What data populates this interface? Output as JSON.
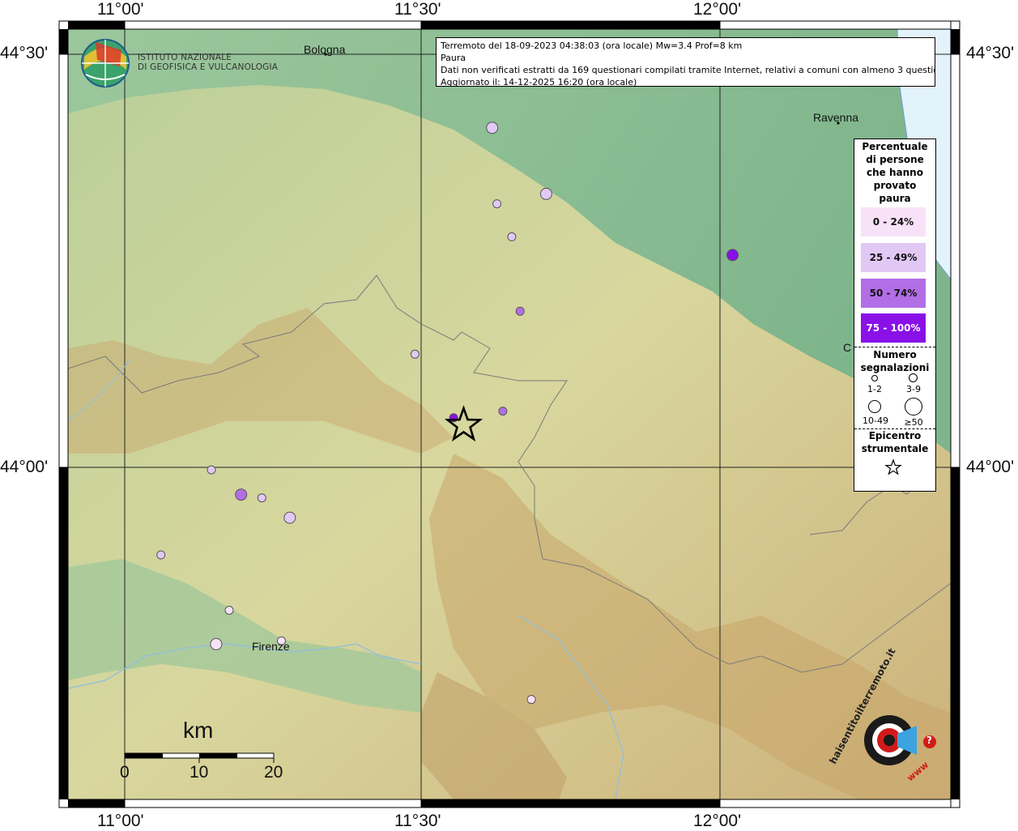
{
  "header": {
    "line1": "Terremoto del 18-09-2023 04:38:03 (ora locale) Mw=3.4 Prof=8 km",
    "line2": "Paura",
    "line3": "Dati non verificati estratti da 169 questionari compilati tramite Internet, relativi a comuni con almeno 3 questionari.",
    "line4": "Aggiornato il: 14-12-2025 16:20 (ora locale)"
  },
  "logo": {
    "line1": "ISTITUTO NAZIONALE",
    "line2": "DI GEOFISICA E VULCANOLOGIA"
  },
  "coords": {
    "top": [
      "11°00'",
      "11°30'",
      "12°00'"
    ],
    "bottom": [
      "11°00'",
      "11°30'",
      "12°00'"
    ],
    "left": [
      "44°30'",
      "44°00'"
    ],
    "right": [
      "44°30'",
      "44°00'"
    ]
  },
  "cities": {
    "bologna": "Bologna",
    "ravenna": "Ravenna",
    "firenze": "Firenze",
    "cesena_partial": "C"
  },
  "legend": {
    "title": "Percentuale di persone che hanno provato paura",
    "classes": [
      {
        "label": "0 - 24%",
        "color": "#f8e2f8"
      },
      {
        "label": "25 - 49%",
        "color": "#e2c8f4"
      },
      {
        "label": "50 - 74%",
        "color": "#b26ee6"
      },
      {
        "label": "75 - 100%",
        "color": "#8a10e8"
      }
    ],
    "count_title": "Numero segnalazioni",
    "count_labels": [
      "1-2",
      "3-9",
      "10-49",
      "≥50"
    ],
    "epicenter_title": "Epicentro strumentale"
  },
  "scale": {
    "title": "km",
    "ticks": [
      "0",
      "10",
      "20"
    ]
  },
  "stamp": {
    "text": "haisentitoilterremoto.it",
    "url": "www",
    "mark": "?"
  },
  "points": [
    {
      "lon": 11.619,
      "lat": 44.411,
      "fear": "25 - 49%",
      "count": "3-9"
    },
    {
      "lon": 11.627,
      "lat": 44.319,
      "fear": "25 - 49%",
      "count": "1-2"
    },
    {
      "lon": 11.71,
      "lat": 44.331,
      "fear": "25 - 49%",
      "count": "3-9"
    },
    {
      "lon": 11.652,
      "lat": 44.279,
      "fear": "25 - 49%",
      "count": "1-2"
    },
    {
      "lon": 11.666,
      "lat": 44.189,
      "fear": "50 - 74%",
      "count": "1-2"
    },
    {
      "lon": 11.489,
      "lat": 44.137,
      "fear": "25 - 49%",
      "count": "1-2"
    },
    {
      "lon": 11.637,
      "lat": 44.068,
      "fear": "50 - 74%",
      "count": "1-2"
    },
    {
      "lon": 11.554,
      "lat": 44.06,
      "fear": "75 - 100%",
      "count": "1-2"
    },
    {
      "lon": 12.024,
      "lat": 44.257,
      "fear": "75 - 100%",
      "count": "3-9"
    },
    {
      "lon": 11.146,
      "lat": 43.997,
      "fear": "25 - 49%",
      "count": "1-2"
    },
    {
      "lon": 11.196,
      "lat": 43.967,
      "fear": "50 - 74%",
      "count": "3-9"
    },
    {
      "lon": 11.231,
      "lat": 43.963,
      "fear": "25 - 49%",
      "count": "1-2"
    },
    {
      "lon": 11.278,
      "lat": 43.939,
      "fear": "25 - 49%",
      "count": "3-9"
    },
    {
      "lon": 11.061,
      "lat": 43.894,
      "fear": "25 - 49%",
      "count": "1-2"
    },
    {
      "lon": 11.176,
      "lat": 43.827,
      "fear": "0 - 24%",
      "count": "1-2"
    },
    {
      "lon": 11.154,
      "lat": 43.786,
      "fear": "0 - 24%",
      "count": "3-9"
    },
    {
      "lon": 11.264,
      "lat": 43.79,
      "fear": "0 - 24%",
      "count": "1-2"
    },
    {
      "lon": 11.685,
      "lat": 43.719,
      "fear": "0 - 24%",
      "count": "1-2"
    }
  ],
  "epicenter": {
    "lon": 11.571,
    "lat": 44.051
  }
}
